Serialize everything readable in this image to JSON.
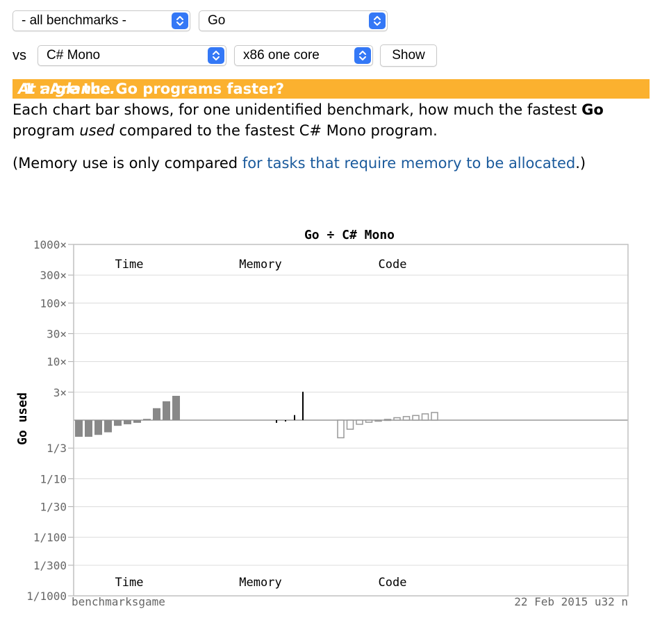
{
  "controls": {
    "benchmark_select": "- all benchmarks -",
    "language_select": "Go",
    "vs_label": "vs",
    "compare_select": "C# Mono",
    "platform_select": "x86 one core",
    "show_button": "Show"
  },
  "section": {
    "heading_prefix": "1 : Are the Go programs faster?",
    "heading_italic": "At a glance.",
    "p1_part1": "Each chart bar shows, for one unidentified benchmark, how much the fastest ",
    "p1_bold": "Go",
    "p1_part2": " program ",
    "p1_italic": "used",
    "p1_part3": " compared to the fastest C# Mono program.",
    "p2_part1": "(Memory use is only compared ",
    "p2_link": "for tasks that require memory to be allocated",
    "p2_part2": ".)"
  },
  "colors": {
    "header_bg": "#fbb12f",
    "time_bar": "#888888",
    "memory_line": "#000000",
    "code_bar_stroke": "#999999",
    "link": "#1a5a9c"
  },
  "chart_data": {
    "type": "bar",
    "title": "Go ÷ C# Mono",
    "ylabel": "Go used",
    "yscale": "log",
    "ylim": [
      0.001,
      1000
    ],
    "yticks": [
      {
        "value": 1000,
        "label": "1000×"
      },
      {
        "value": 300,
        "label": "300×"
      },
      {
        "value": 100,
        "label": "100×"
      },
      {
        "value": 30,
        "label": "30×"
      },
      {
        "value": 10,
        "label": "10×"
      },
      {
        "value": 3,
        "label": "3×"
      },
      {
        "value": 0.3333,
        "label": "1/3"
      },
      {
        "value": 0.1,
        "label": "1/10"
      },
      {
        "value": 0.0333,
        "label": "1/30"
      },
      {
        "value": 0.01,
        "label": "1/100"
      },
      {
        "value": 0.00333,
        "label": "1/300"
      },
      {
        "value": 0.001,
        "label": "1/1000"
      }
    ],
    "group_labels": [
      "Time",
      "Memory",
      "Code"
    ],
    "grid": true,
    "footer_left": "benchmarksgame",
    "footer_right": "22 Feb 2015 u32 n",
    "series": [
      {
        "name": "Time",
        "values": [
          0.52,
          0.52,
          0.56,
          0.62,
          0.8,
          0.85,
          0.9,
          1.05,
          1.6,
          2.1,
          2.6
        ]
      },
      {
        "name": "Memory",
        "values": [
          0.9,
          0.95,
          1.22,
          3.05
        ]
      },
      {
        "name": "Code",
        "values": [
          0.5,
          0.7,
          0.85,
          0.92,
          0.96,
          1.03,
          1.1,
          1.15,
          1.2,
          1.28,
          1.35
        ]
      }
    ]
  }
}
